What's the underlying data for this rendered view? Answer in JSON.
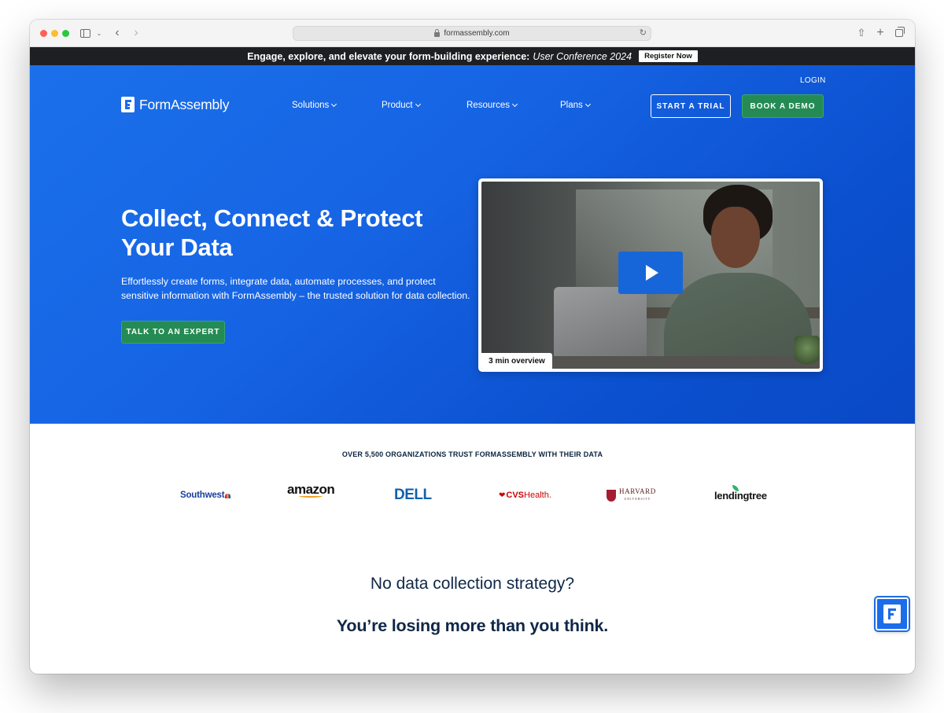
{
  "browser": {
    "url": "formassembly.com",
    "icons": [
      "sidebar-icon",
      "chevron-down-icon",
      "back-icon",
      "forward-icon",
      "lock-icon",
      "reload-icon",
      "share-icon",
      "new-tab-icon",
      "tabs-overview-icon"
    ]
  },
  "announcement": {
    "text": "Engage, explore, and elevate your form-building experience:",
    "event": "User Conference 2024",
    "cta": "Register Now"
  },
  "header": {
    "login": "LOGIN",
    "logo_text": "FormAssembly",
    "nav": [
      "Solutions",
      "Product",
      "Resources",
      "Plans"
    ],
    "trial_button": "START A TRIAL",
    "demo_button": "BOOK A DEMO"
  },
  "hero": {
    "title": "Collect, Connect & Protect Your Data",
    "subtitle": "Effortlessly create forms, integrate data, automate processes, and protect sensitive information with FormAssembly – the trusted solution for data collection.",
    "cta": "TALK TO AN EXPERT",
    "video_badge": "3 min overview"
  },
  "trust": {
    "heading": "OVER 5,500 ORGANIZATIONS TRUST FORMASSEMBLY WITH THEIR DATA",
    "logos": {
      "southwest": "Southwest",
      "amazon": "amazon",
      "dell": "DELL",
      "cvs_brand": "CVS",
      "cvs_health": "Health.",
      "harvard": "HARVARD",
      "harvard_sub": "UNIVERSITY",
      "lendingtree": "lendingtree"
    }
  },
  "section": {
    "question": "No data collection strategy?",
    "answer": "You’re losing more than you think."
  },
  "colors": {
    "hero_blue": "#1b6de9",
    "cta_green": "#258b54",
    "announce_bg": "#1d1f22",
    "heading_navy": "#0f2747"
  }
}
